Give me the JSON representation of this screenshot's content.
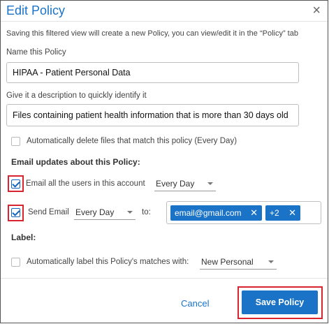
{
  "dialog": {
    "title": "Edit Policy",
    "close_icon": "close-icon",
    "intro": "Saving this filtered view will create a new Policy, you can view/edit it in the “Policy” tab"
  },
  "name_field": {
    "label": "Name this Policy",
    "value": "HIPAA - Patient Personal Data"
  },
  "description_field": {
    "label": "Give it a description to quickly identify it",
    "value": "Files containing patient health information that is more than 30 days old"
  },
  "auto_delete": {
    "label": "Automatically delete files that match this policy (Every Day)",
    "checked": false
  },
  "email_updates": {
    "heading": "Email updates about this Policy:",
    "email_all_users": {
      "label": "Email all the users in this account",
      "checked": true,
      "frequency": "Every Day"
    },
    "send_email": {
      "label": "Send Email",
      "checked": true,
      "frequency": "Every Day",
      "to_label": "to:",
      "recipients": [
        "email@gmail.com",
        "+2"
      ]
    }
  },
  "label_section": {
    "heading": "Label:",
    "auto_label": {
      "label": "Automatically label this Policy's matches with:",
      "checked": false,
      "value": "New Personal"
    }
  },
  "footer": {
    "cancel_label": "Cancel",
    "save_label": "Save Policy"
  },
  "colors": {
    "accent": "#1a73c7",
    "highlight_border": "#d9232e"
  }
}
